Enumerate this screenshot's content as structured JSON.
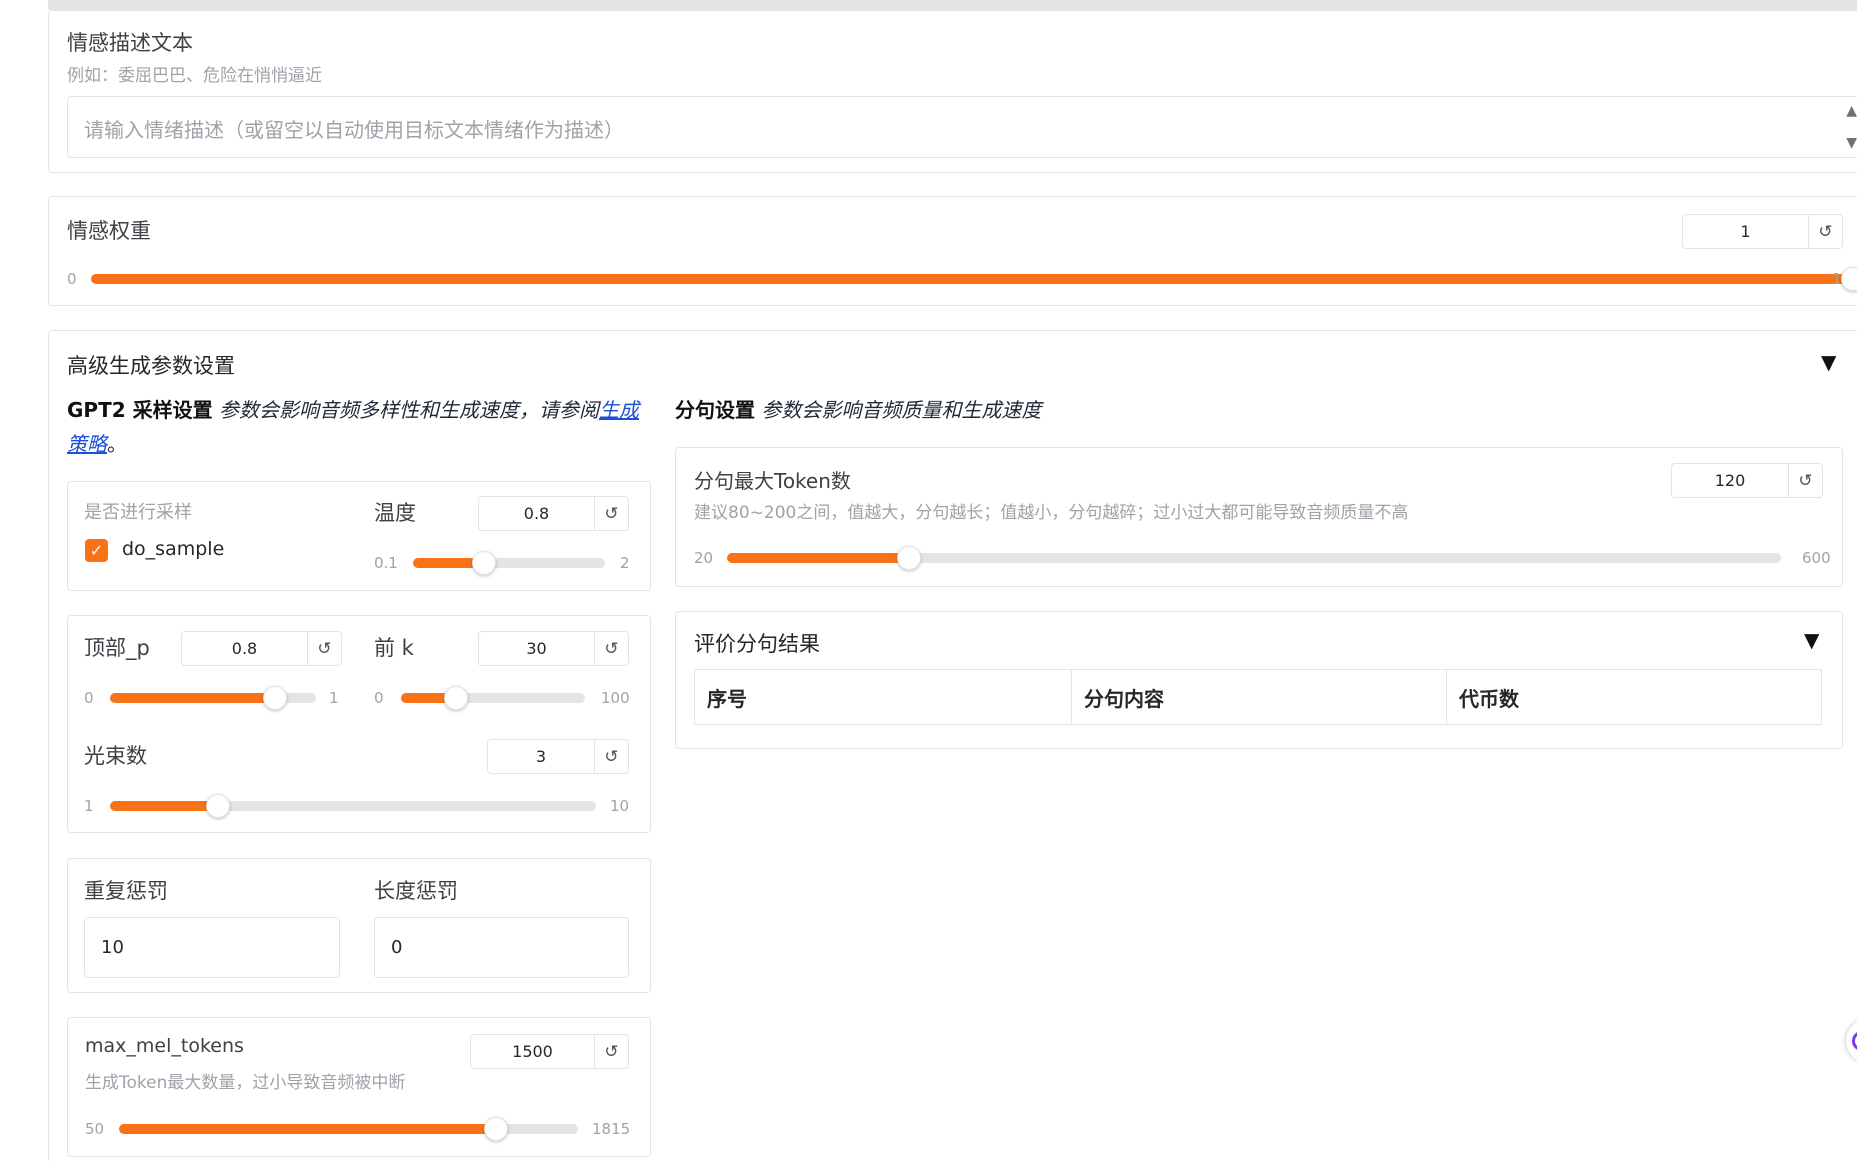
{
  "emotion_text": {
    "label": "情感描述文本",
    "info": "例如：委屈巴巴、危险在悄悄逼近",
    "placeholder": "请输入情绪描述（或留空以自动使用目标文本情绪作为描述）"
  },
  "emotion_weight": {
    "label": "情感权重",
    "value": "1",
    "min": "0",
    "max": "1",
    "fraction": 1.0
  },
  "advanced": {
    "title": "高级生成参数设置",
    "gpt2": {
      "prefix": "GPT2 ",
      "bold": "采样设置",
      "desc": " 参数会影响音频多样性和生成速度，请参阅",
      "link": "生成策略",
      "end": "。"
    },
    "do_sample": {
      "label": "是否进行采样",
      "option": "do_sample",
      "checked": true
    },
    "temperature": {
      "label": "温度",
      "value": "0.8",
      "min": "0.1",
      "max": "2",
      "fraction": 0.37
    },
    "top_p": {
      "label": "顶部_p",
      "value": "0.8",
      "min": "0",
      "max": "1",
      "fraction": 0.8
    },
    "top_k": {
      "label": "前 k",
      "value": "30",
      "min": "0",
      "max": "100",
      "fraction": 0.3
    },
    "num_beams": {
      "label": "光束数",
      "value": "3",
      "min": "1",
      "max": "10",
      "fraction": 0.2222
    },
    "repetition_penalty": {
      "label": "重复惩罚",
      "value": "10"
    },
    "length_penalty": {
      "label": "长度惩罚",
      "value": "0"
    },
    "max_mel_tokens": {
      "label": "max_mel_tokens",
      "info": "生成Token最大数量，过小导致音频被中断",
      "value": "1500",
      "min": "50",
      "max": "1815",
      "fraction": 0.8215
    },
    "segment": {
      "bold": "分句设置",
      "desc": " 参数会影响音频质量和生成速度"
    },
    "max_tokens_per_segment": {
      "label": "分句最大Token数",
      "info": "建议80~200之间，值越大，分句越长；值越小，分句越碎；过小过大都可能导致音频质量不高",
      "value": "120",
      "min": "20",
      "max": "600",
      "fraction": 0.1724
    },
    "preview": {
      "title": "评价分句结果",
      "columns": [
        "序号",
        "分句内容",
        "代币数"
      ]
    }
  },
  "colors": {
    "accent": "#f97316",
    "border": "#e4e4e7",
    "link": "#1d4ed8"
  },
  "icons": {
    "reset": "↺",
    "collapse": "▼"
  }
}
